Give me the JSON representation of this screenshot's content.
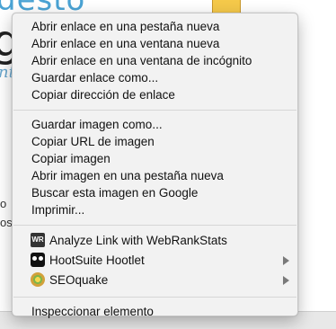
{
  "background": {
    "title_fragment": "desto",
    "big_fragment": "g",
    "italic_fragment": "nte",
    "side_fragment_1": "o",
    "side_fragment_2": "os"
  },
  "menu": {
    "group_links": [
      "Abrir enlace en una pestaña nueva",
      "Abrir enlace en una ventana nueva",
      "Abrir enlace en una ventana de incógnito",
      "Guardar enlace como...",
      "Copiar dirección de enlace"
    ],
    "group_image": [
      "Guardar imagen como...",
      "Copiar URL de imagen",
      "Copiar imagen",
      "Abrir imagen en una pestaña nueva",
      "Buscar esta imagen en Google",
      "Imprimir..."
    ],
    "group_extensions": [
      {
        "label": "Analyze Link with WebRankStats",
        "icon": "webrankstats-icon",
        "icon_text": "WR",
        "submenu": false
      },
      {
        "label": "HootSuite Hootlet",
        "icon": "hootsuite-owl-icon",
        "submenu": true
      },
      {
        "label": "SEOquake",
        "icon": "seoquake-icon",
        "submenu": true
      }
    ],
    "group_inspect": [
      "Inspeccionar elemento"
    ]
  }
}
